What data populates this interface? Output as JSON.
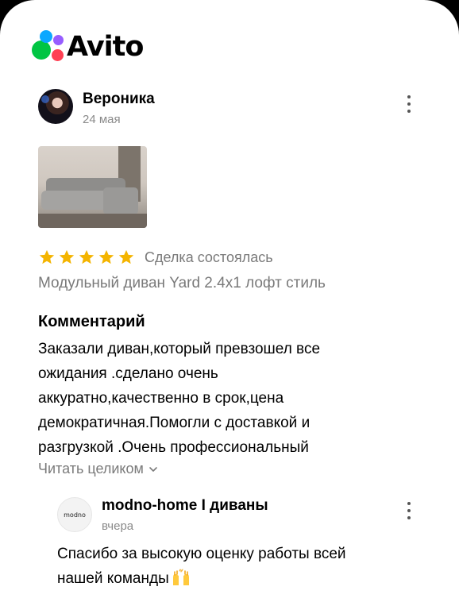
{
  "app": {
    "logo_text": "Avito",
    "logo_colors": {
      "green": "#00c543",
      "blue": "#0aa8ff",
      "purple": "#975dff",
      "red": "#ff4053"
    }
  },
  "review": {
    "author": "Вероника",
    "date": "24 мая",
    "avatar_icon": "user-photo",
    "photo_icon": "sofa-photo",
    "rating": 5,
    "rating_max": 5,
    "star_color": "#f4b400",
    "deal_status": "Сделка состоялась",
    "product": "Модульный диван Yard 2.4x1 лофт стиль",
    "comment_heading": "Комментарий",
    "comment_lines": [
      "Заказали диван,который превзошел все",
      "ожидания .сделано очень",
      "аккуратно,качественно в срок,цена",
      "демократичная.Помогли с доставкой и",
      "разгрузкой .Очень профессиональный"
    ],
    "read_more": "Читать целиком"
  },
  "reply": {
    "author": "modno-home I диваны",
    "avatar_text": "modno",
    "date": "вчера",
    "text_lines": [
      "Спасибо за высокую оценку работы всей",
      "нашей команды"
    ],
    "emoji_icon": "raising-hands-emoji"
  }
}
